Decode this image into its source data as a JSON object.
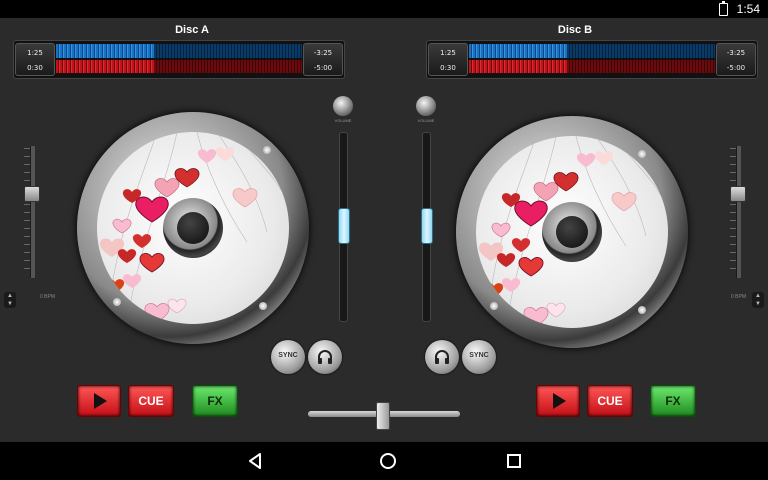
{
  "status_bar": {
    "time": "1:54"
  },
  "deck_a": {
    "title": "Disc A",
    "elapsed": "1:25",
    "elapsed2": "0:30",
    "remaining": "-3:25",
    "remaining2": "-5:00",
    "volume_label": "VOLUME",
    "bpm_label": "0 BPM",
    "sync_label": "SYNC",
    "cue_label": "CUE",
    "fx_label": "FX"
  },
  "deck_b": {
    "title": "Disc B",
    "elapsed": "1:25",
    "elapsed2": "0:30",
    "remaining": "-3:25",
    "remaining2": "-5:00",
    "volume_label": "VOLUME",
    "bpm_label": "0 BPM",
    "sync_label": "SYNC",
    "cue_label": "CUE",
    "fx_label": "FX"
  },
  "colors": {
    "accent_red": "#e0232a",
    "accent_green": "#3fbf3f",
    "wave_blue": "#1a7dd6",
    "wave_red": "#c0141a"
  },
  "icons": [
    "play-icon",
    "headphones-icon",
    "back-icon",
    "home-icon",
    "recents-icon",
    "battery-icon"
  ]
}
